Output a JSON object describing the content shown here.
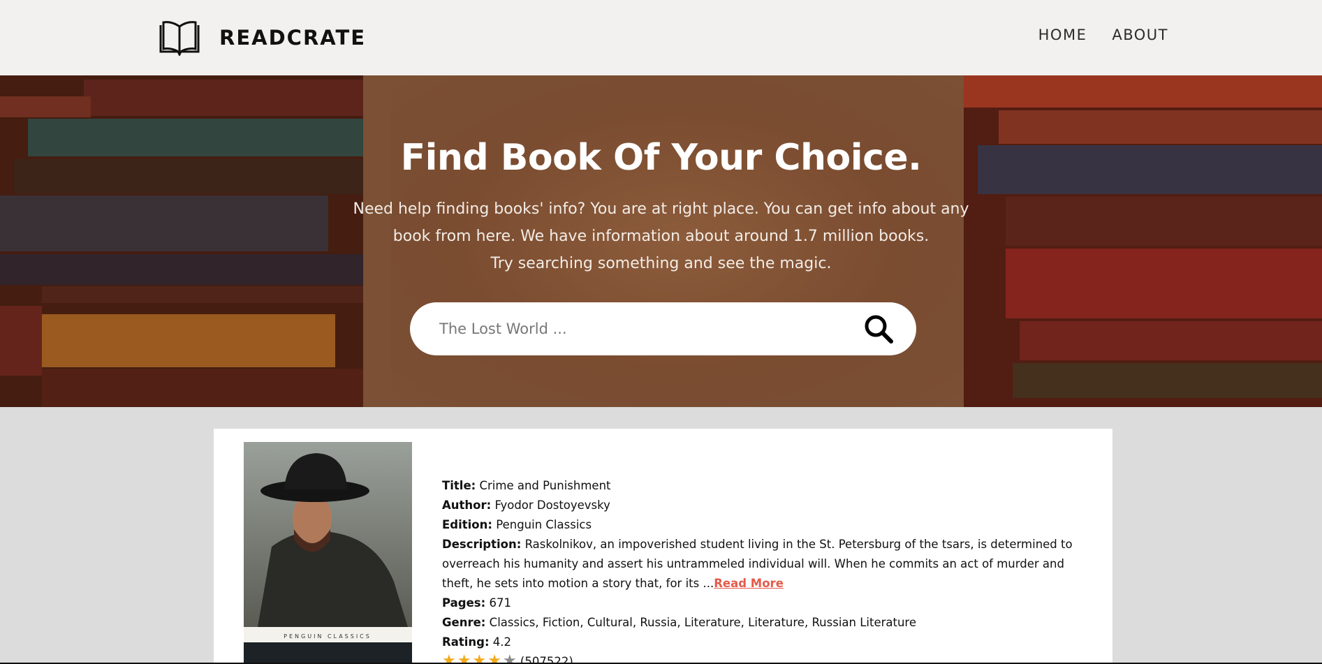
{
  "brand": {
    "name": "READCRATE",
    "icon": "open-book-icon"
  },
  "nav": {
    "home": "HOME",
    "about": "ABOUT"
  },
  "hero": {
    "title": "Find Book Of Your Choice.",
    "subtitle_lines": [
      "Need help finding books' info? You are at right place. You can get info about any",
      "book from here. We have information about around 1.7 million books.",
      "Try searching something and see the magic."
    ]
  },
  "search": {
    "placeholder": "The Lost World ...",
    "icon": "search-icon"
  },
  "book": {
    "title_label": "Title:",
    "title": "Crime and Punishment",
    "author_label": "Author:",
    "author": "Fyodor Dostoyevsky",
    "edition_label": "Edition:",
    "edition": "Penguin Classics",
    "description_label": "Description:",
    "description": "Raskolnikov, an impoverished student living in the St. Petersburg of the tsars, is determined to overreach his humanity and assert his untrammeled individual will. When he commits an act of murder and theft, he sets into motion a story that, for its ...",
    "read_more": "Read More",
    "pages_label": "Pages:",
    "pages": "671",
    "genre_label": "Genre:",
    "genre": "Classics, Fiction, Cultural, Russia, Literature, Literature, Russian Literature",
    "rating_label": "Rating:",
    "rating": "4.2",
    "rating_stars_filled": 4,
    "rating_count": "(507522)",
    "cover_text": "PENGUIN  CLASSICS"
  },
  "colors": {
    "accent": "#e45b4a",
    "star": "#f2a91b",
    "navbar_bg": "#f2f1ef",
    "page_bg": "#dcdcdc"
  }
}
